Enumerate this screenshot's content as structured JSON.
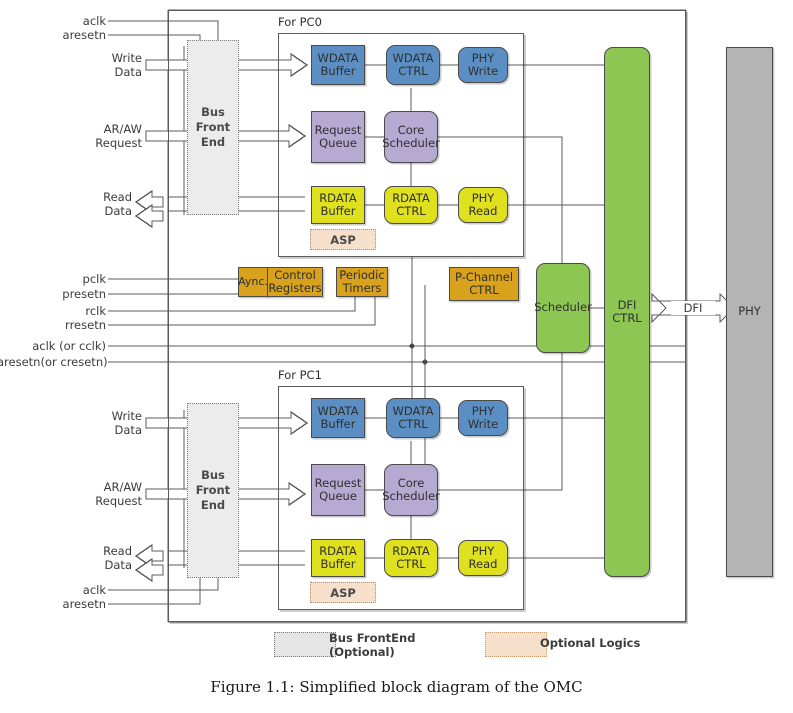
{
  "figure": {
    "caption": "Figure 1.1: Simplified block diagram of the OMC"
  },
  "colors": {
    "blue": "#5b8fc4",
    "purple": "#b6a9d2",
    "yellow": "#dfe01e",
    "green": "#8dc653",
    "gold": "#d8a21c",
    "grey": "#b4b4b4",
    "bus_front_end": "#ececec",
    "optional_logic": "#f7e0cb",
    "line": "#5b5b5b"
  },
  "signals": {
    "top": [
      {
        "name": "aclk"
      },
      {
        "name": "aresetn"
      }
    ],
    "middle": [
      {
        "name": "pclk"
      },
      {
        "name": "presetn"
      },
      {
        "name": "rclk"
      },
      {
        "name": "rresetn"
      },
      {
        "name": "aclk (or cclk)"
      },
      {
        "name": "aresetn(or cresetn)"
      }
    ],
    "bottom": [
      {
        "name": "aclk"
      },
      {
        "name": "aresetn"
      }
    ]
  },
  "ports": {
    "write_data": "Write\nData",
    "write_data_l1": "Write",
    "write_data_l2": "Data",
    "araw_request_l1": "AR/AW",
    "araw_request_l2": "Request",
    "read_data_l1": "Read",
    "read_data_l2": "Data"
  },
  "pc0": {
    "title": "For PC0",
    "bus_front_end": "Bus\nFront\nEnd",
    "blocks": [
      {
        "id": "wdata-buffer",
        "label": "WDATA\nBuffer",
        "color": "blue",
        "shape": "rect"
      },
      {
        "id": "wdata-ctrl",
        "label": "WDATA\nCTRL",
        "color": "blue",
        "shape": "round"
      },
      {
        "id": "phy-write",
        "label": "PHY\nWrite",
        "color": "blue",
        "shape": "round"
      },
      {
        "id": "request-queue",
        "label": "Request\nQueue",
        "color": "purple",
        "shape": "rect"
      },
      {
        "id": "core-scheduler",
        "label": "Core\nScheduler",
        "color": "purple",
        "shape": "round"
      },
      {
        "id": "rdata-buffer",
        "label": "RDATA\nBuffer",
        "color": "yellow",
        "shape": "rect"
      },
      {
        "id": "rdata-ctrl",
        "label": "RDATA\nCTRL",
        "color": "yellow",
        "shape": "round"
      },
      {
        "id": "phy-read",
        "label": "PHY\nRead",
        "color": "yellow",
        "shape": "round"
      },
      {
        "id": "asp",
        "label": "ASP",
        "color": "optional",
        "shape": "rect"
      }
    ]
  },
  "pc1": {
    "title": "For PC1",
    "bus_front_end": "Bus\nFront\nEnd",
    "blocks": [
      {
        "id": "wdata-buffer",
        "label": "WDATA\nBuffer",
        "color": "blue",
        "shape": "rect"
      },
      {
        "id": "wdata-ctrl",
        "label": "WDATA\nCTRL",
        "color": "blue",
        "shape": "round"
      },
      {
        "id": "phy-write",
        "label": "PHY\nWrite",
        "color": "blue",
        "shape": "round"
      },
      {
        "id": "request-queue",
        "label": "Request\nQueue",
        "color": "purple",
        "shape": "rect"
      },
      {
        "id": "core-scheduler",
        "label": "Core\nScheduler",
        "color": "purple",
        "shape": "round"
      },
      {
        "id": "rdata-buffer",
        "label": "RDATA\nBuffer",
        "color": "yellow",
        "shape": "rect"
      },
      {
        "id": "rdata-ctrl",
        "label": "RDATA\nCTRL",
        "color": "yellow",
        "shape": "round"
      },
      {
        "id": "phy-read",
        "label": "PHY\nRead",
        "color": "yellow",
        "shape": "round"
      },
      {
        "id": "asp",
        "label": "ASP",
        "color": "optional",
        "shape": "rect"
      }
    ]
  },
  "common": {
    "aync": "Aync.",
    "control_registers_l1": "Control",
    "control_registers_l2": "Registers",
    "periodic_timers_l1": "Periodic",
    "periodic_timers_l2": "Timers",
    "pchannel_ctrl_l1": "P-Channel",
    "pchannel_ctrl_l2": "CTRL",
    "scheduler": "Scheduler",
    "dfi_ctrl_l1": "DFI",
    "dfi_ctrl_l2": "CTRL",
    "dfi_bus": "DFI",
    "phy": "PHY"
  },
  "legend": {
    "bus_frontend_l1": "Bus FrontEnd",
    "bus_frontend_l2": "(Optional)",
    "optional_logics": "Optional Logics"
  }
}
